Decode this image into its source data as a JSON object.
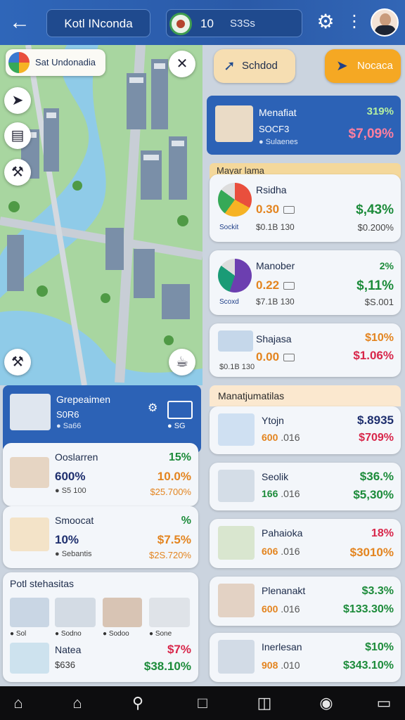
{
  "topbar": {
    "title": "Kotl INconda",
    "center_number": "10",
    "center_label": "S3Ss",
    "icons": {
      "back": "arrow-left-icon",
      "settings": "gear-icon",
      "more": "more-vertical-icon"
    }
  },
  "map": {
    "location_label": "Sat Undonadia",
    "colors": {
      "water": "#8fcbe8",
      "grass": "#a8d6a0",
      "road": "#c8ced6"
    }
  },
  "right": {
    "chips": [
      {
        "label": "Schdod",
        "bg": "#f6deb2"
      },
      {
        "label": "Nocaca",
        "bg": "#f5a823"
      }
    ],
    "featured": {
      "title": "Menafiat",
      "pct": "319%",
      "sub": "SOCF3",
      "status": "Sulaenes",
      "value": "$7,09%"
    },
    "section1_title": "Mayar lama",
    "group1": [
      {
        "name": "Rsidha",
        "value": "0.30",
        "small": "$0.1B 130",
        "tag": "Sockit",
        "pct": "$,43%",
        "amount": "$0.200%"
      },
      {
        "name": "Manober",
        "value": "0.22",
        "small": "$7.1B 130",
        "tag": "Scoxd",
        "pct": "2%",
        "pct2": "$,11%",
        "amount": "$S.001"
      },
      {
        "name": "Shajasa",
        "value": "0.00",
        "small": "$0.1B 130",
        "pct": "$10%",
        "amount": "$1.06%"
      }
    ],
    "section2_title": "Manatjumatilas",
    "group2": [
      {
        "name": "Ytojn",
        "value": "600",
        "small": ".016",
        "pct": "$.8935",
        "amount": "$709%"
      },
      {
        "name": "Seolik",
        "value": "166",
        "small": ".016",
        "pct": "$36.%",
        "amount": "$5,30%"
      },
      {
        "name": "Pahaioka",
        "value": "606",
        "small": ".016",
        "pct": "18%",
        "amount": "$3010%"
      },
      {
        "name": "Plenanakt",
        "value": "600",
        "small": ".016",
        "pct": "$3.3%",
        "amount": "$133.30%"
      },
      {
        "name": "Inerlesan",
        "value": "908",
        "small": ".010",
        "pct": "$10%",
        "amount": "$343.10%"
      }
    ]
  },
  "left": {
    "header": {
      "title": "Grepeaimen",
      "sub": "S0R6",
      "status": "Sa66",
      "status2": "SG"
    },
    "cards": [
      {
        "name": "Ooslarren",
        "value": "600%",
        "small": "S5 100",
        "pct": "15%",
        "pct2": "10.0%",
        "amount": "$25.700%"
      },
      {
        "name": "Smoocat",
        "value": "10%",
        "small": "Sebantis",
        "pct": "%",
        "pct2": "$7.5%",
        "amount": "$2S.720%"
      }
    ],
    "section_title": "Potl stehasitas",
    "row_labels": [
      "Sol",
      "Sodno",
      "Sodoo",
      "Sone"
    ],
    "last": {
      "name": "Natea",
      "value": "$636",
      "pct": "$7%",
      "amount": "$38.10%"
    }
  },
  "nav": {
    "icons": [
      "home-icon",
      "house-icon",
      "search-icon",
      "square-icon",
      "book-icon",
      "camera-icon",
      "folder-icon"
    ]
  }
}
